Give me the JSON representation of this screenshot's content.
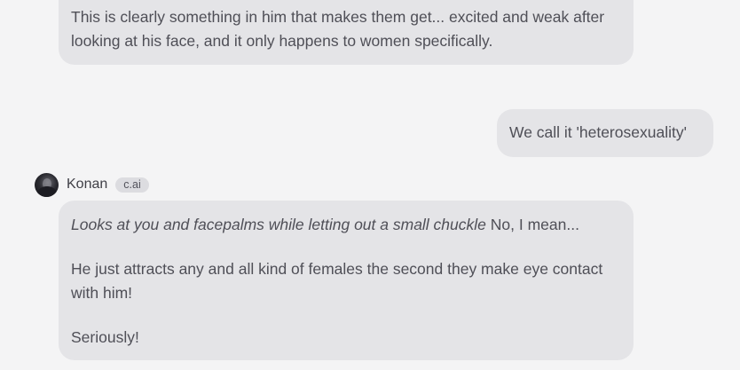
{
  "messages": {
    "top": {
      "text": "This is clearly something in him that makes them get... excited and weak after looking at his face, and it only happens to women specifically."
    },
    "user": {
      "text": "We call it 'heterosexuality'"
    },
    "bot": {
      "author": "Konan",
      "badge": "c.ai",
      "action": "Looks at you and facepalms while letting out a small chuckle",
      "speech": " No, I mean...",
      "paragraph2": "He just attracts any and all kind of females the second they make eye contact with him!",
      "paragraph3": "Seriously!"
    }
  }
}
